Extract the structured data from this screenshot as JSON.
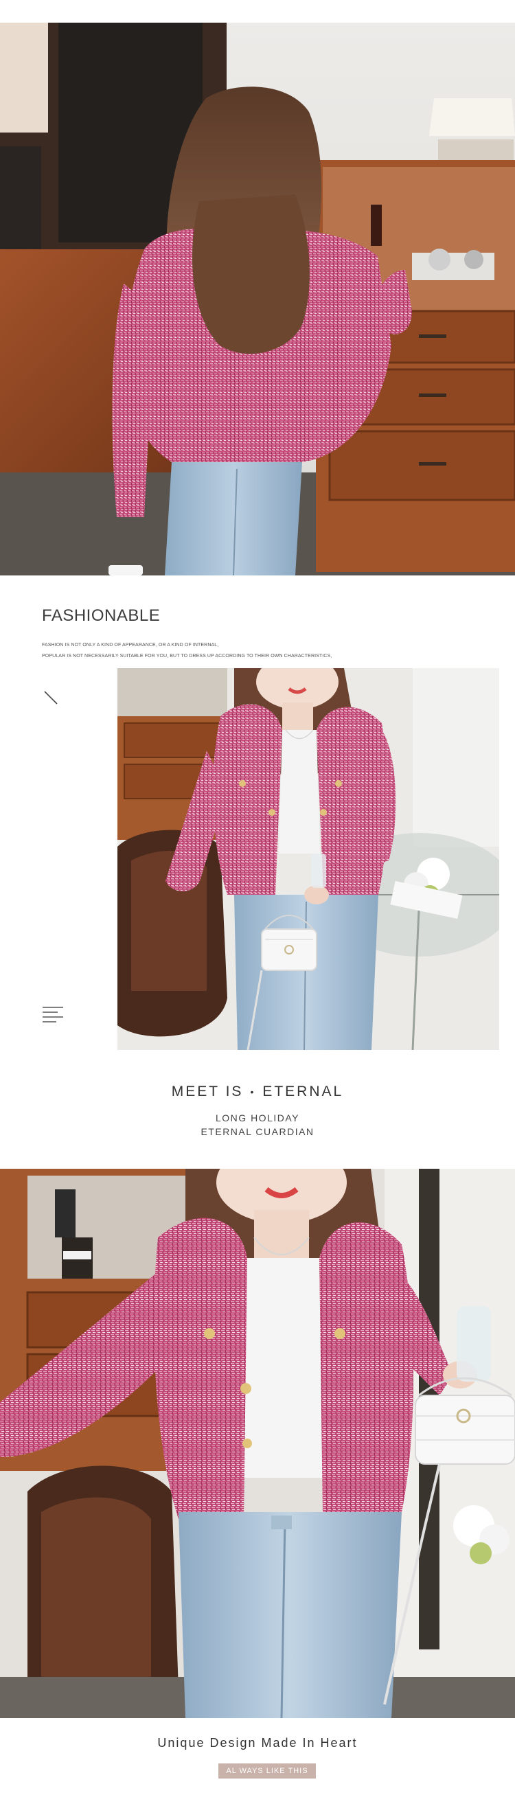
{
  "sections": {
    "fashionable": {
      "title": "FASHIONABLE",
      "description_line1": "FASHION IS NOT ONLY A KIND OF APPEARANCE, OR A KIND OF INTERNAL,",
      "description_line2": "POPULAR IS NOT NECESSARILY SUITABLE FOR YOU, BUT TO DRESS UP ACCORDING TO THEIR OWN CHARACTERISTICS,"
    },
    "meet": {
      "heading_left": "MEET IS",
      "heading_dot": "•",
      "heading_right": "ETERNAL",
      "sub_line1": "LONG HOLIDAY",
      "sub_line2": "ETERNAL CUARDIAN"
    },
    "unique": {
      "heading": "Unique Design Made In Heart",
      "badge": "AL WAYS LIKE THIS"
    }
  },
  "icons": {
    "slash": "diagonal-slash-icon",
    "menu": "menu-lines-icon"
  },
  "colors": {
    "jacket_pink": "#c9537f",
    "badge_bg": "#c8b2a9",
    "denim": "#9fb8cf",
    "wood": "#8a4a26"
  }
}
